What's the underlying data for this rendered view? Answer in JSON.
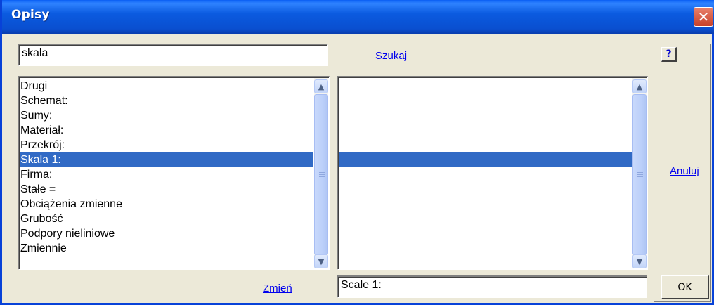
{
  "window": {
    "title": "Opisy",
    "close_glyph": "✕"
  },
  "search": {
    "value": "skala",
    "link_label": "Szukaj"
  },
  "left_list": {
    "items": [
      "Drugi",
      "Schemat:",
      "Sumy:",
      "Materiał:",
      "Przekrój:",
      "Skala 1:",
      "Firma:",
      "Stałe =",
      "Obciążenia zmienne",
      "Grubość",
      "Podpory nieliniowe",
      "Zmiennie"
    ],
    "selected_index": 5
  },
  "right_list": {
    "items": [
      "",
      "",
      "",
      "",
      "",
      "",
      "",
      "",
      "",
      "",
      "",
      ""
    ],
    "selected_index": 5
  },
  "change_link": "Zmień",
  "edit_field": {
    "value": "Scale 1:"
  },
  "side": {
    "help_label": "?",
    "cancel_label": "Anuluj",
    "ok_label": "OK"
  },
  "icons": {
    "up": "scroll-up-arrow-icon",
    "down": "scroll-down-arrow-icon"
  },
  "colors": {
    "titlebar": "#0a5ff4",
    "selection": "#316ac5",
    "link": "#0000ee"
  }
}
